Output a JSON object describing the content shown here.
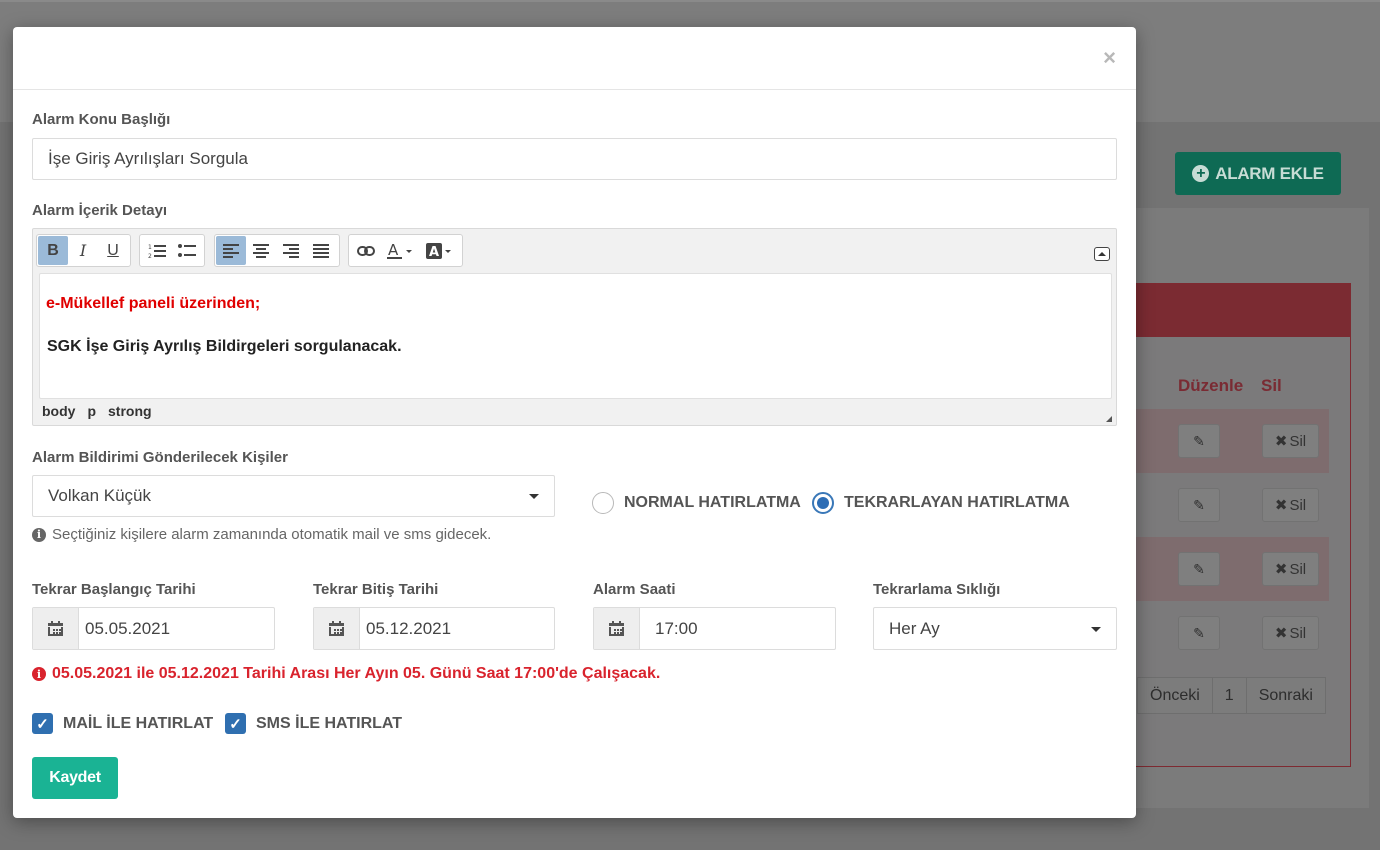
{
  "background": {
    "add_button_label": "ALARM EKLE",
    "add_button_icon": "plus-circle-icon",
    "columns": {
      "edit": "Düzenle",
      "delete": "Sil"
    },
    "rows": [
      {
        "delete_label": "Sil"
      },
      {
        "delete_label": "Sil"
      },
      {
        "delete_label": "Sil"
      },
      {
        "delete_label": "Sil"
      }
    ],
    "pager": {
      "prev": "Önceki",
      "page": "1",
      "next": "Sonraki"
    },
    "accent_color": "#0e6a54",
    "danger_color": "#7b2b32"
  },
  "modal": {
    "close_label": "×",
    "subject": {
      "label": "Alarm Konu Başlığı",
      "value": "İşe Giriş Ayrılışları Sorgula"
    },
    "detail": {
      "label": "Alarm İçerik Detayı",
      "toolbar": {
        "bold": "B",
        "italic": "I",
        "underline": "U"
      },
      "content_line1": "e-Mükellef paneli üzerinden;",
      "content_line2": "SGK İşe Giriş Ayrılış Bildirgeleri sorgulanacak.",
      "path": [
        "body",
        "p",
        "strong"
      ]
    },
    "recipients": {
      "label": "Alarm Bildirimi Gönderilecek Kişiler",
      "selected": "Volkan Küçük",
      "help": "Seçtiğiniz kişilere alarm zamanında otomatik mail ve sms gidecek."
    },
    "reminder_type": {
      "normal": "NORMAL HATIRLATMA",
      "recurring": "TEKRARLAYAN HATIRLATMA",
      "selected": "recurring"
    },
    "start_date": {
      "label": "Tekrar Başlangıç Tarihi",
      "value": "05.05.2021"
    },
    "end_date": {
      "label": "Tekrar Bitiş Tarihi",
      "value": "05.12.2021"
    },
    "alarm_time": {
      "label": "Alarm Saati",
      "value": "17:00"
    },
    "frequency": {
      "label": "Tekrarlama Sıklığı",
      "selected": "Her Ay"
    },
    "schedule_notice": "05.05.2021 ile 05.12.2021 Tarihi Arası Her Ayın 05. Günü Saat 17:00'de Çalışacak.",
    "mail_reminder": {
      "label": "MAİL İLE HATIRLAT",
      "checked": true
    },
    "sms_reminder": {
      "label": "SMS İLE HATIRLAT",
      "checked": true
    },
    "save_label": "Kaydet",
    "save_color": "#1ab394",
    "notice_color": "#d9232d"
  }
}
